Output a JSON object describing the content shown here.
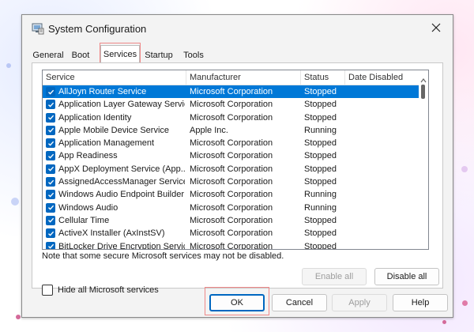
{
  "window": {
    "title": "System Configuration",
    "tabs": [
      {
        "label": "General",
        "active": false
      },
      {
        "label": "Boot",
        "active": false
      },
      {
        "label": "Services",
        "active": true
      },
      {
        "label": "Startup",
        "active": false
      },
      {
        "label": "Tools",
        "active": false
      }
    ]
  },
  "services": {
    "columns": [
      "Service",
      "Manufacturer",
      "Status",
      "Date Disabled"
    ],
    "rows": [
      {
        "service": "AllJoyn Router Service",
        "manufacturer": "Microsoft Corporation",
        "status": "Stopped",
        "date_disabled": "",
        "checked": true,
        "selected": true
      },
      {
        "service": "Application Layer Gateway Service",
        "manufacturer": "Microsoft Corporation",
        "status": "Stopped",
        "date_disabled": "",
        "checked": true,
        "selected": false
      },
      {
        "service": "Application Identity",
        "manufacturer": "Microsoft Corporation",
        "status": "Stopped",
        "date_disabled": "",
        "checked": true,
        "selected": false
      },
      {
        "service": "Apple Mobile Device Service",
        "manufacturer": "Apple Inc.",
        "status": "Running",
        "date_disabled": "",
        "checked": true,
        "selected": false
      },
      {
        "service": "Application Management",
        "manufacturer": "Microsoft Corporation",
        "status": "Stopped",
        "date_disabled": "",
        "checked": true,
        "selected": false
      },
      {
        "service": "App Readiness",
        "manufacturer": "Microsoft Corporation",
        "status": "Stopped",
        "date_disabled": "",
        "checked": true,
        "selected": false
      },
      {
        "service": "AppX Deployment Service (App...",
        "manufacturer": "Microsoft Corporation",
        "status": "Stopped",
        "date_disabled": "",
        "checked": true,
        "selected": false
      },
      {
        "service": "AssignedAccessManager Service",
        "manufacturer": "Microsoft Corporation",
        "status": "Stopped",
        "date_disabled": "",
        "checked": true,
        "selected": false
      },
      {
        "service": "Windows Audio Endpoint Builder",
        "manufacturer": "Microsoft Corporation",
        "status": "Running",
        "date_disabled": "",
        "checked": true,
        "selected": false
      },
      {
        "service": "Windows Audio",
        "manufacturer": "Microsoft Corporation",
        "status": "Running",
        "date_disabled": "",
        "checked": true,
        "selected": false
      },
      {
        "service": "Cellular Time",
        "manufacturer": "Microsoft Corporation",
        "status": "Stopped",
        "date_disabled": "",
        "checked": true,
        "selected": false
      },
      {
        "service": "ActiveX Installer (AxInstSV)",
        "manufacturer": "Microsoft Corporation",
        "status": "Stopped",
        "date_disabled": "",
        "checked": true,
        "selected": false
      },
      {
        "service": "BitLocker Drive Encryption Service",
        "manufacturer": "Microsoft Corporation",
        "status": "Stopped",
        "date_disabled": "",
        "checked": true,
        "selected": false
      }
    ],
    "note": "Note that some secure Microsoft services may not be disabled.",
    "enable_all_label": "Enable all",
    "disable_all_label": "Disable all",
    "hide_ms_label": "Hide all Microsoft services"
  },
  "buttons": {
    "ok": "OK",
    "cancel": "Cancel",
    "apply": "Apply",
    "help": "Help"
  },
  "colors": {
    "accent": "#0078d7",
    "highlight_box": "#e88888"
  },
  "icons": {
    "app": "system-configuration-icon",
    "close": "close-icon",
    "checkbox": "checkbox-checked-icon",
    "scroll_up": "chevron-up-icon"
  }
}
